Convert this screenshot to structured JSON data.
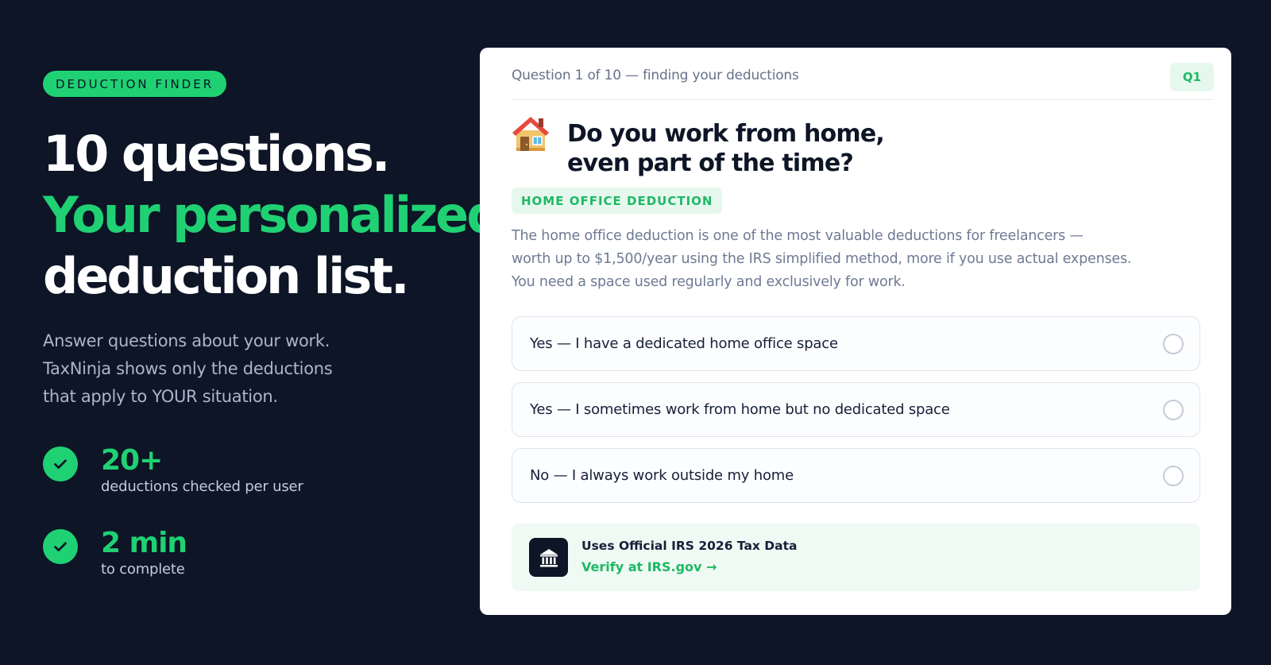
{
  "hero": {
    "eyebrow": "DEDUCTION FINDER",
    "headline_line1": "10 questions.",
    "headline_line2": "Your personalized",
    "headline_line3": "deduction list.",
    "lede_line1": "Answer questions about your work.",
    "lede_line2": "TaxNinja shows only the deductions",
    "lede_line3": "that apply to YOUR situation."
  },
  "stats": [
    {
      "value": "20+",
      "label": "deductions checked per user",
      "icon": "check-icon"
    },
    {
      "value": "2 min",
      "label": "to complete",
      "icon": "check-icon"
    }
  ],
  "quiz": {
    "progress_text": "Question 1 of 10 — finding your deductions",
    "question_badge": "Q1",
    "question_icon": "house-icon",
    "question_line1": "Do you work from home,",
    "question_line2": "even part of the time?",
    "category": "HOME OFFICE DEDUCTION",
    "description_line1": "The home office deduction is one of the most valuable deductions for freelancers —",
    "description_line2": "worth up to $1,500/year using the IRS simplified method, more if you use actual expenses.",
    "description_line3": "You need a space used regularly and exclusively for work.",
    "options": [
      {
        "label": "Yes — I have a dedicated home office space",
        "selected": false
      },
      {
        "label": "Yes — I sometimes work from home but no dedicated space",
        "selected": false
      },
      {
        "label": "No — I always work outside my home",
        "selected": false
      }
    ],
    "trust": {
      "icon": "bank-icon",
      "title": "Uses Official IRS 2026 Tax Data",
      "link": "Verify at IRS.gov →"
    }
  },
  "colors": {
    "background": "#0d1526",
    "accent": "#1fd173",
    "accent_text": "#1fb865",
    "card": "#ffffff"
  }
}
